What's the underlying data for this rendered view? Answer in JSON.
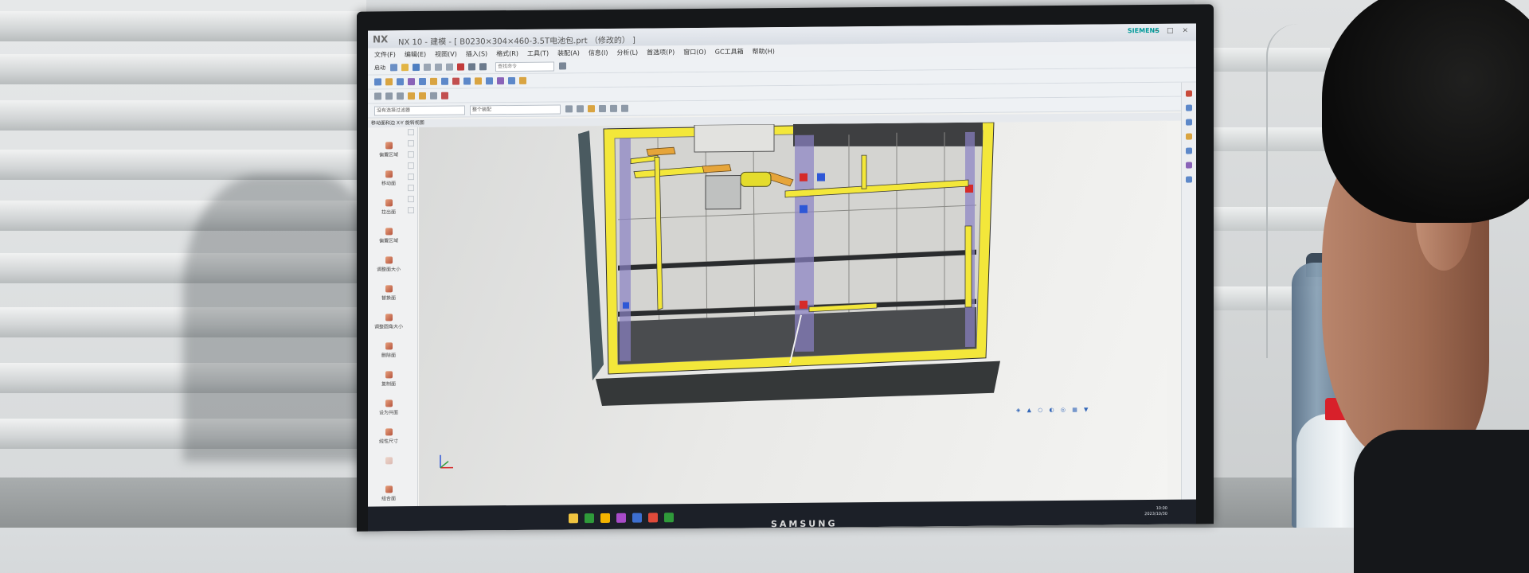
{
  "app": {
    "logo_text": "NX",
    "title": "NX 10 - 建模 - [ B0230×304×460-3.5T电池包.prt （修改的） ]",
    "vendor": "SIEMENS",
    "window_controls": "– □ ×"
  },
  "menu": [
    "文件(F)",
    "编辑(E)",
    "视图(V)",
    "插入(S)",
    "格式(R)",
    "工具(T)",
    "装配(A)",
    "信息(I)",
    "分析(L)",
    "首选项(P)",
    "窗口(O)",
    "GC工具箱",
    "帮助(H)"
  ],
  "toolbar": {
    "start_label": "启动",
    "search_placeholder": "查找命令",
    "filter_value": "没有选择过滤器",
    "assembly_value": "整个装配"
  },
  "ribbon_caption": "移动面和边  X-Y 旋转视图",
  "left_commands": [
    "偏置区域",
    "移动面",
    "拉出面",
    "偏置区域",
    "调整面大小",
    "替换面",
    "调整圆角大小",
    "删除面",
    "复制面",
    "设为共面",
    "线性尺寸",
    "",
    "组合面"
  ],
  "monitor": {
    "brand": "SAMSUNG"
  },
  "clock": {
    "time": "10:00",
    "date": "2023/10/30"
  },
  "colors": {
    "frame_yellow": "#f3e73a",
    "busbar_orange": "#e6a53a",
    "cell_grey": "#d4d4d1",
    "terminal_red": "#d52a2a",
    "terminal_blue": "#2e57d6",
    "housing_dark": "#3a3d40",
    "cap_red": "#d8202a"
  },
  "icons": [
    "window-minimize-icon",
    "window-maximize-icon",
    "window-close-icon",
    "search-icon",
    "view-triad-icon",
    "snap-icon"
  ]
}
